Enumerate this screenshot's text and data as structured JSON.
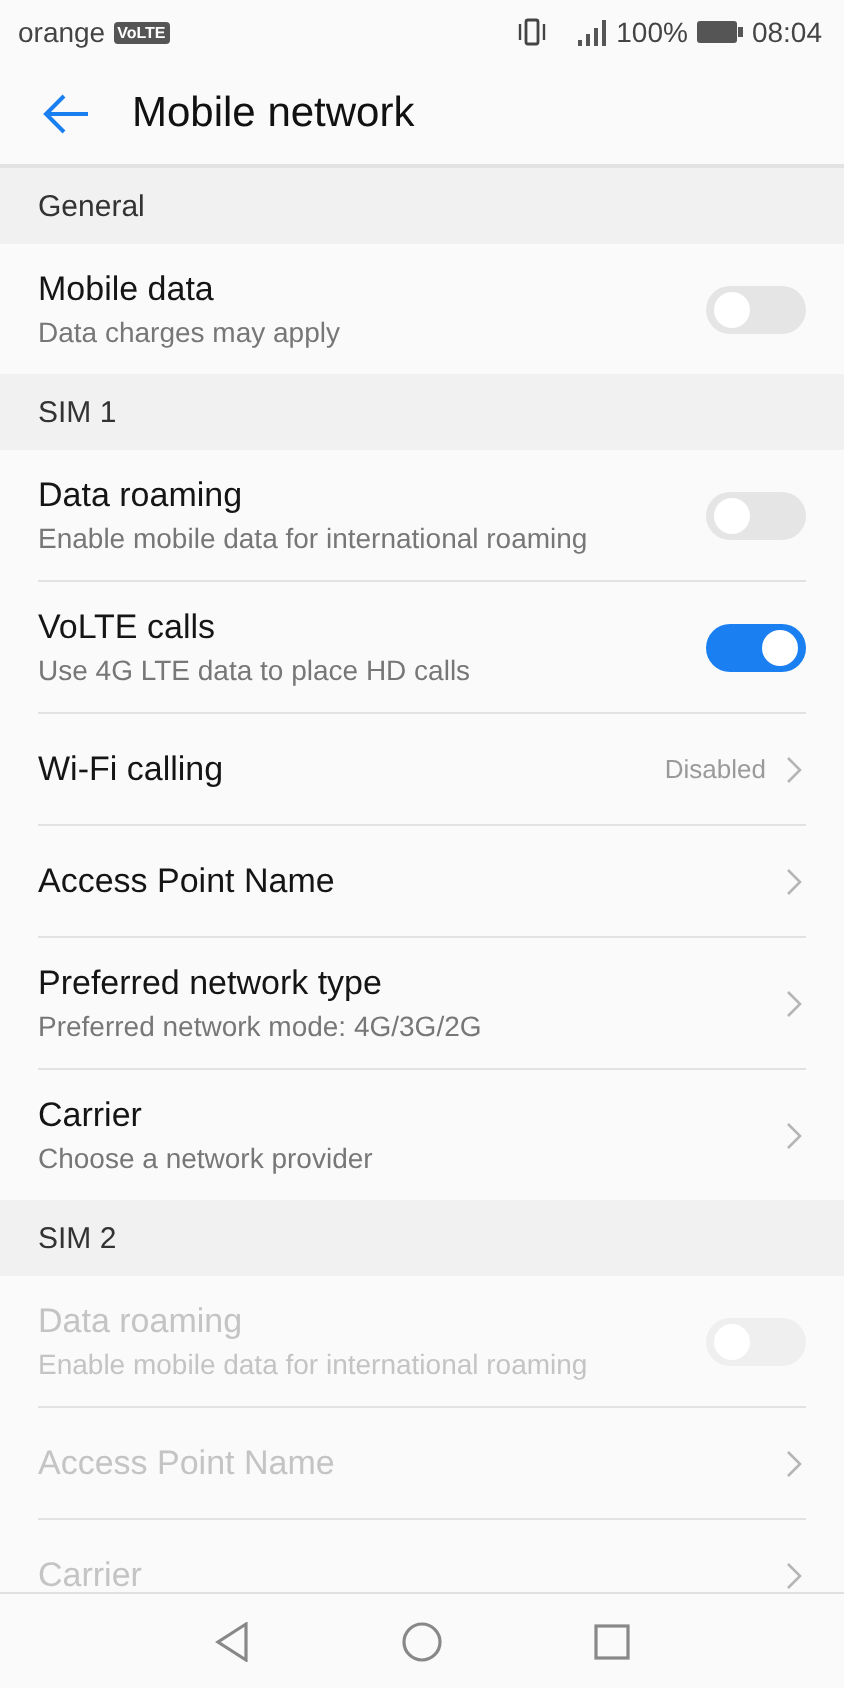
{
  "status_bar": {
    "carrier": "orange",
    "badge": "VoLTE",
    "battery": "100%",
    "time": "08:04"
  },
  "app_bar": {
    "title": "Mobile network"
  },
  "sections": [
    {
      "header": "General",
      "rows": [
        {
          "kind": "toggle",
          "title": "Mobile data",
          "subtitle": "Data charges may apply",
          "on": false,
          "disabled": false
        }
      ]
    },
    {
      "header": "SIM 1",
      "rows": [
        {
          "kind": "toggle",
          "title": "Data roaming",
          "subtitle": "Enable mobile data for international roaming",
          "on": false,
          "disabled": false
        },
        {
          "kind": "toggle",
          "title": "VoLTE calls",
          "subtitle": "Use 4G LTE data to place HD calls",
          "on": true,
          "disabled": false
        },
        {
          "kind": "link",
          "title": "Wi-Fi calling",
          "value": "Disabled",
          "disabled": false
        },
        {
          "kind": "link",
          "title": "Access Point Name",
          "disabled": false
        },
        {
          "kind": "link",
          "title": "Preferred network type",
          "subtitle": "Preferred network mode: 4G/3G/2G",
          "disabled": false
        },
        {
          "kind": "link",
          "title": "Carrier",
          "subtitle": "Choose a network provider",
          "disabled": false
        }
      ]
    },
    {
      "header": "SIM 2",
      "rows": [
        {
          "kind": "toggle",
          "title": "Data roaming",
          "subtitle": "Enable mobile data for international roaming",
          "on": false,
          "disabled": true
        },
        {
          "kind": "link",
          "title": "Access Point Name",
          "disabled": true
        },
        {
          "kind": "link",
          "title": "Carrier",
          "disabled": true
        }
      ]
    }
  ]
}
